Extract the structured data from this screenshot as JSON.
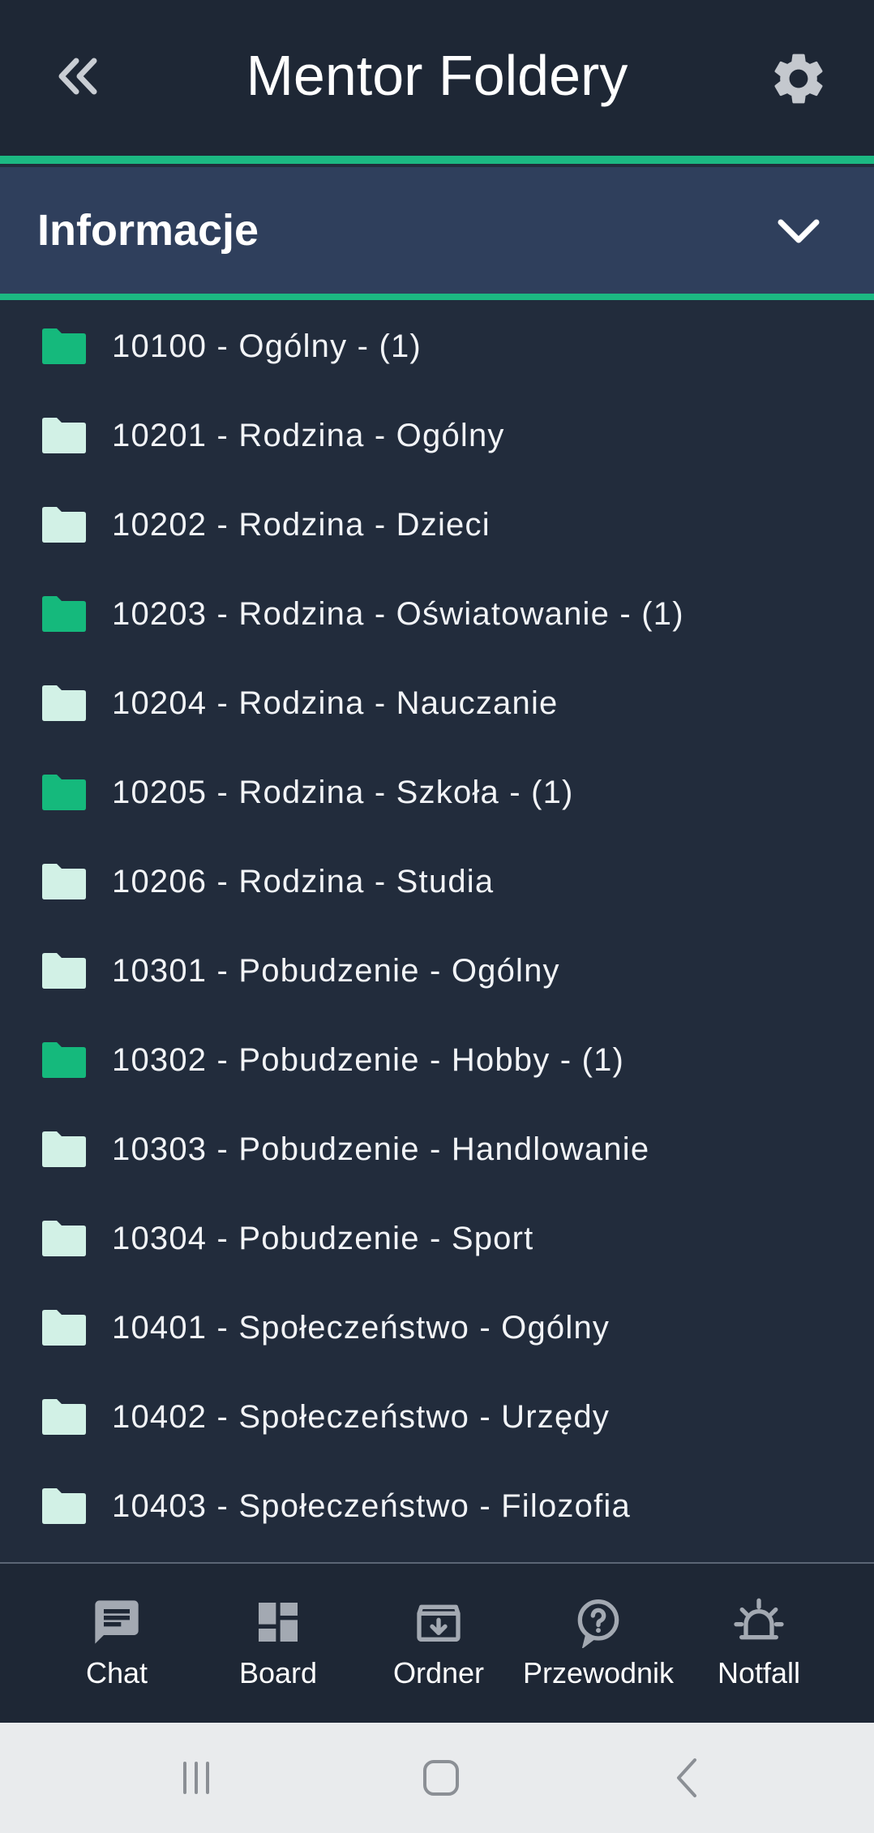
{
  "header": {
    "title": "Mentor Foldery",
    "back_icon": "double-chevron-left-icon",
    "settings_icon": "gear-icon"
  },
  "section": {
    "title": "Informacje",
    "toggle_icon": "chevron-down-icon"
  },
  "colors": {
    "accent": "#1cb882",
    "folder_filled": "#15b97c",
    "folder_empty": "#d2f1e6",
    "background": "#222c3c",
    "header_bg": "#1e2735",
    "section_bg": "#2f3f5c"
  },
  "folders": [
    {
      "label": "10100 - Ogólny - (1)",
      "has_items": true
    },
    {
      "label": "10201 - Rodzina - Ogólny",
      "has_items": false
    },
    {
      "label": "10202 - Rodzina - Dzieci",
      "has_items": false
    },
    {
      "label": "10203 - Rodzina - Oświatowanie - (1)",
      "has_items": true
    },
    {
      "label": "10204 - Rodzina - Nauczanie",
      "has_items": false
    },
    {
      "label": "10205 - Rodzina - Szkoła - (1)",
      "has_items": true
    },
    {
      "label": "10206 - Rodzina - Studia",
      "has_items": false
    },
    {
      "label": "10301 - Pobudzenie - Ogólny",
      "has_items": false
    },
    {
      "label": "10302 - Pobudzenie - Hobby - (1)",
      "has_items": true
    },
    {
      "label": "10303 - Pobudzenie - Handlowanie",
      "has_items": false
    },
    {
      "label": "10304 - Pobudzenie - Sport",
      "has_items": false
    },
    {
      "label": "10401 - Społeczeństwo - Ogólny",
      "has_items": false
    },
    {
      "label": "10402 - Społeczeństwo - Urzędy",
      "has_items": false
    },
    {
      "label": "10403 - Społeczeństwo - Filozofia",
      "has_items": false
    }
  ],
  "bottom_nav": [
    {
      "label": "Chat",
      "icon": "chat-icon"
    },
    {
      "label": "Board",
      "icon": "dashboard-icon"
    },
    {
      "label": "Ordner",
      "icon": "archive-icon"
    },
    {
      "label": "Przewodnik",
      "icon": "help-icon"
    },
    {
      "label": "Notfall",
      "icon": "alarm-light-icon"
    }
  ],
  "system_nav": {
    "recents_icon": "recents-icon",
    "home_icon": "home-icon",
    "back_icon": "back-icon"
  }
}
